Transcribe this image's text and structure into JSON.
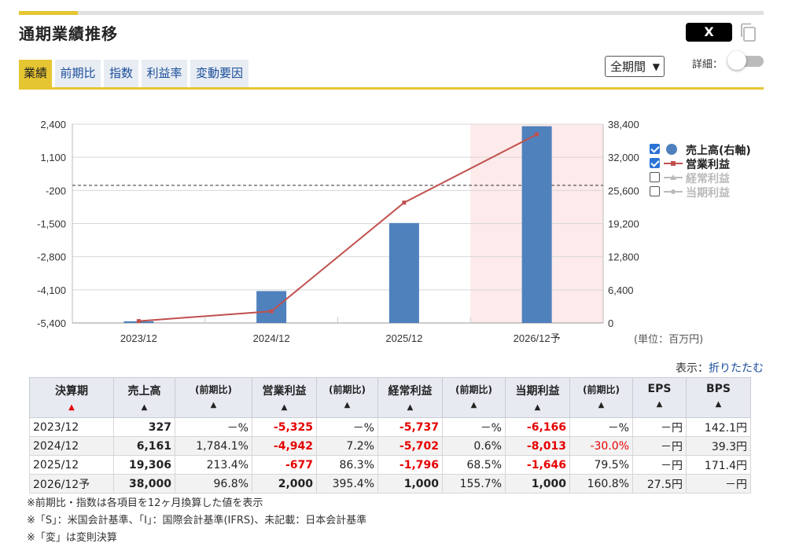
{
  "header": {
    "title": "通期業績推移",
    "share_label": "X",
    "period_select": "全期間",
    "detail_label": "詳細："
  },
  "tabs": [
    {
      "label": "業績",
      "active": true
    },
    {
      "label": "前期比",
      "active": false
    },
    {
      "label": "指数",
      "active": false
    },
    {
      "label": "利益率",
      "active": false
    },
    {
      "label": "変動要因",
      "active": false
    }
  ],
  "chart_data": {
    "type": "bar",
    "categories": [
      "2023/12",
      "2024/12",
      "2025/12",
      "2026/12予"
    ],
    "series": [
      {
        "name": "売上高(右軸)",
        "kind": "bar",
        "axis": "right",
        "color": "#4f81bd",
        "values": [
          327,
          6161,
          19306,
          38000
        ]
      },
      {
        "name": "営業利益",
        "kind": "line",
        "axis": "left",
        "color": "#c0504d",
        "values": [
          -5325,
          -4942,
          -677,
          2000
        ]
      }
    ],
    "left_axis": {
      "ticks": [
        "2,400",
        "1,100",
        "-200",
        "-1,500",
        "-2,800",
        "-4,100",
        "-5,400"
      ],
      "ylim": [
        -5400,
        2400
      ]
    },
    "right_axis": {
      "ticks": [
        "38,400",
        "32,000",
        "25,600",
        "19,200",
        "12,800",
        "6,400",
        "0"
      ],
      "ylim": [
        0,
        38400
      ]
    },
    "forecast_category": "2026/12予",
    "zero_line": 0,
    "legend_position": "right",
    "grid": true
  },
  "legend": [
    {
      "label": "売上高(右軸)",
      "checked": true,
      "symbol": "dot",
      "color": "#4f81bd"
    },
    {
      "label": "営業利益",
      "checked": true,
      "symbol": "line",
      "color": "#c0504d"
    },
    {
      "label": "経常利益",
      "checked": false,
      "symbol": "line",
      "color": "#bbbbbb"
    },
    {
      "label": "当期利益",
      "checked": false,
      "symbol": "line",
      "color": "#bbbbbb"
    }
  ],
  "unit_label": "(単位：百万円)",
  "fold": {
    "prefix": "表示：",
    "link": "折りたたむ"
  },
  "table": {
    "headers": [
      "決算期",
      "売上高",
      "(前期比)",
      "営業利益",
      "(前期比)",
      "経常利益",
      "(前期比)",
      "当期利益",
      "(前期比)",
      "EPS",
      "BPS"
    ],
    "rows": [
      [
        "2023/12",
        "327",
        "－%",
        "-5,325",
        "－%",
        "-5,737",
        "－%",
        "-6,166",
        "－%",
        "－円",
        "142.1円"
      ],
      [
        "2024/12",
        "6,161",
        "1,784.1%",
        "-4,942",
        "7.2%",
        "-5,702",
        "0.6%",
        "-8,013",
        "-30.0%",
        "－円",
        "39.3円"
      ],
      [
        "2025/12",
        "19,306",
        "213.4%",
        "-677",
        "86.3%",
        "-1,796",
        "68.5%",
        "-1,646",
        "79.5%",
        "－円",
        "171.4円"
      ],
      [
        "2026/12予",
        "38,000",
        "96.8%",
        "2,000",
        "395.4%",
        "1,000",
        "155.7%",
        "1,000",
        "160.8%",
        "27.5円",
        "－円"
      ]
    ]
  },
  "notes": [
    "※前期比・指数は各項目を12ヶ月換算した値を表示",
    "※「S」：米国会計基準、「I」：国際会計基準(IFRS)、未記載：日本会計基準",
    "※「変」は変則決算"
  ]
}
